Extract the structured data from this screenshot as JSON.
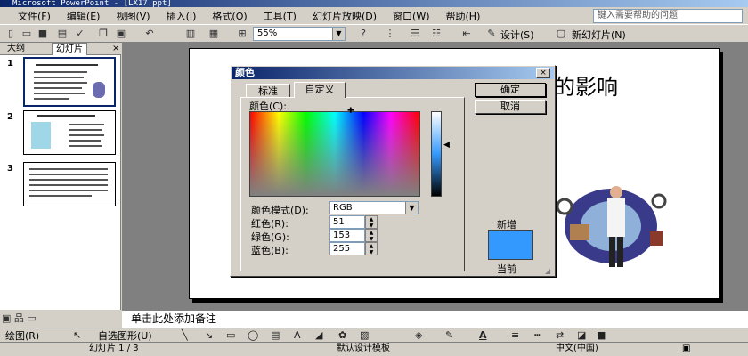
{
  "window": {
    "title": "Microsoft PowerPoint - [LX17.ppt]"
  },
  "menu": [
    "文件(F)",
    "编辑(E)",
    "视图(V)",
    "插入(I)",
    "格式(O)",
    "工具(T)",
    "幻灯片放映(D)",
    "窗口(W)",
    "帮助(H)"
  ],
  "help_placeholder": "键入需要帮助的问题",
  "toolbar": {
    "zoom": "55%",
    "design_label": "设计(S)",
    "new_slide_label": "新幻灯片(N)"
  },
  "left_tabs": {
    "outline": "大纲",
    "slides": "幻灯片",
    "close": "×"
  },
  "slides": [
    {
      "number": "1"
    },
    {
      "number": "2"
    },
    {
      "number": "3"
    }
  ],
  "slide_title_visible": "的影响",
  "notes_placeholder": "单击此处添加备注",
  "dialog": {
    "title": "颜色",
    "close": "×",
    "tabs": [
      "标准",
      "自定义"
    ],
    "colors_label": "颜色(C):",
    "ok": "确定",
    "cancel": "取消",
    "mode_label": "颜色模式(D):",
    "mode_value": "RGB",
    "red_label": "红色(R):",
    "red_value": "51",
    "green_label": "绿色(G):",
    "green_value": "153",
    "blue_label": "蓝色(B):",
    "blue_value": "255",
    "new_label": "新增",
    "current_label": "当前",
    "new_color": "#3399ff",
    "current_color": "#3399ff"
  },
  "drawbar": {
    "draw_label": "绘图(R)",
    "autoshapes_label": "自选图形(U)"
  },
  "status": {
    "slide": "幻灯片 1 / 3",
    "template": "默认设计模板",
    "language": "中文(中国)"
  }
}
